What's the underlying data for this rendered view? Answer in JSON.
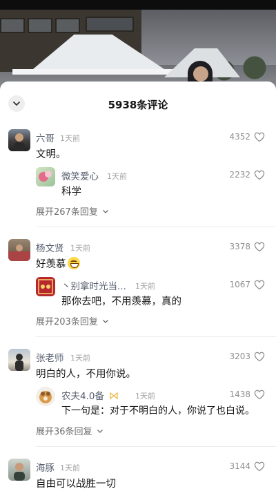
{
  "header": {
    "title": "5938条评论",
    "collapse_icon": "chevron-down-icon"
  },
  "comments": [
    {
      "user": "六哥",
      "time": "1天前",
      "text": "文明。",
      "likes": "4352",
      "reply": {
        "user": "微笑爱心",
        "time": "1天前",
        "text": "科学",
        "likes": "2232"
      },
      "expand": "展开267条回复"
    },
    {
      "user": "杨文贤",
      "time": "1天前",
      "text": "好羡慕",
      "likes": "3378",
      "reply": {
        "user": "丶别拿时光当...",
        "time": "1天前",
        "text": "那你去吧，不用羡慕，真的",
        "likes": "1067"
      },
      "expand": "展开203条回复"
    },
    {
      "user": "张老师",
      "time": "1天前",
      "text": "明白的人，不用你说。",
      "likes": "3203",
      "reply": {
        "user": "农夫4.0备",
        "time": "1天前",
        "text": "下一句是：对于不明白的人，你说了也白说。",
        "likes": "1438"
      },
      "expand": "展开36条回复"
    },
    {
      "user": "海豚",
      "time": "1天前",
      "text": "自由可以战胜一切",
      "likes": "3144"
    }
  ],
  "colors": {
    "username": "#555e6d",
    "meta": "#a3a3a3",
    "text": "#161616"
  }
}
